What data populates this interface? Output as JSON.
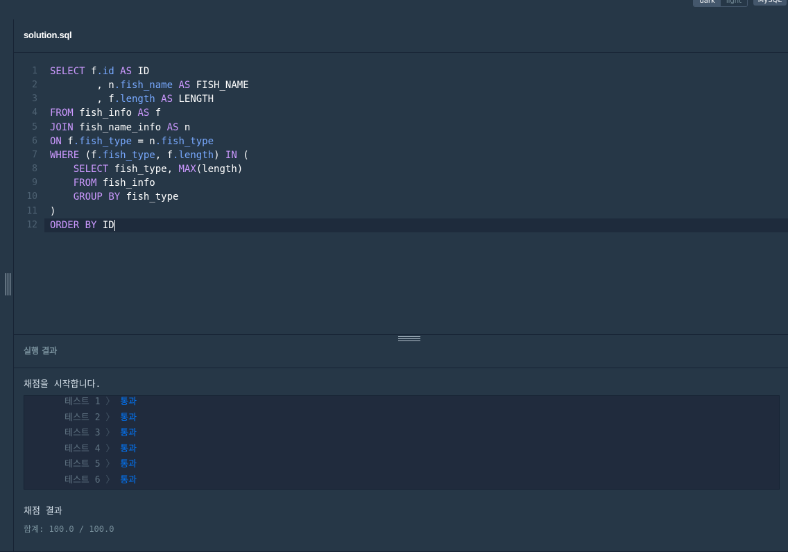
{
  "header": {
    "theme_toggle": {
      "dark_label": "dark",
      "light_label": "light",
      "selected": "dark"
    },
    "language_label": "MySQL"
  },
  "editor": {
    "file_name": "solution.sql",
    "active_line": 12,
    "lines": [
      {
        "num": "1",
        "text": "SELECT f.id AS ID"
      },
      {
        "num": "2",
        "text": "        , n.fish_name AS FISH_NAME"
      },
      {
        "num": "3",
        "text": "        , f.length AS LENGTH"
      },
      {
        "num": "4",
        "text": "FROM fish_info AS f"
      },
      {
        "num": "5",
        "text": "JOIN fish_name_info AS n"
      },
      {
        "num": "6",
        "text": "ON f.fish_type = n.fish_type"
      },
      {
        "num": "7",
        "text": "WHERE (f.fish_type, f.length) IN ("
      },
      {
        "num": "8",
        "text": "    SELECT fish_type, MAX(length)"
      },
      {
        "num": "9",
        "text": "    FROM fish_info"
      },
      {
        "num": "10",
        "text": "    GROUP BY fish_type"
      },
      {
        "num": "11",
        "text": ")"
      },
      {
        "num": "12",
        "text": "ORDER BY ID"
      }
    ],
    "syntax_colors": {
      "keyword": "#cc99ff",
      "field": "#78a9ff",
      "text": "#ffffff"
    }
  },
  "result": {
    "title": "실행 결과",
    "grading_start": "채점을 시작합니다.",
    "tests": [
      {
        "label": "테스트 1",
        "sep": "〉",
        "status": "통과"
      },
      {
        "label": "테스트 2",
        "sep": "〉",
        "status": "통과"
      },
      {
        "label": "테스트 3",
        "sep": "〉",
        "status": "통과"
      },
      {
        "label": "테스트 4",
        "sep": "〉",
        "status": "통과"
      },
      {
        "label": "테스트 5",
        "sep": "〉",
        "status": "통과"
      },
      {
        "label": "테스트 6",
        "sep": "〉",
        "status": "통과"
      }
    ],
    "final_title": "채점 결과",
    "final_sum": "합계: 100.0 / 100.0",
    "pass_color": "#0078ff"
  }
}
